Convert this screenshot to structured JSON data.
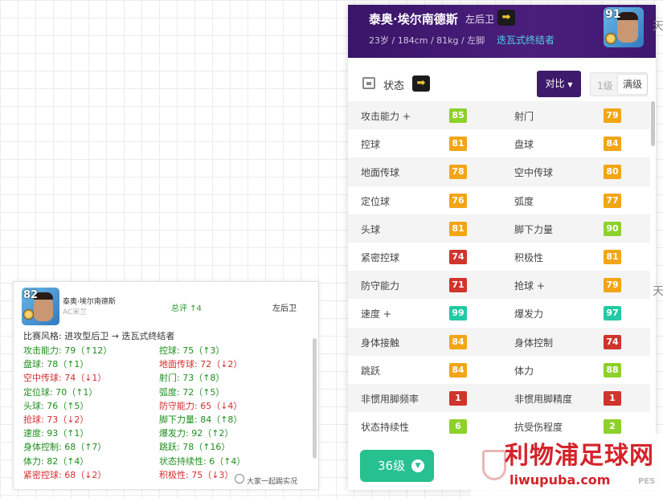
{
  "right_panel": {
    "player_name": "泰奥·埃尔南德斯",
    "position": "左后卫",
    "info": "23岁 / 184cm / 81kg / 左脚",
    "playing_style": "迭瓦式终结者",
    "rating": "91",
    "status_label": "状态",
    "compare_label": "对比",
    "level_1_label": "1级",
    "level_max_label": "满级",
    "level_button_label": "36级",
    "stats": [
      {
        "name": "攻击能力 +",
        "value": "85",
        "color": "#8dd12b"
      },
      {
        "name": "射门",
        "value": "79",
        "color": "#f2a516"
      },
      {
        "name": "控球",
        "value": "81",
        "color": "#f2a516"
      },
      {
        "name": "盘球",
        "value": "84",
        "color": "#f2a516"
      },
      {
        "name": "地面传球",
        "value": "78",
        "color": "#f2a516"
      },
      {
        "name": "空中传球",
        "value": "80",
        "color": "#f2a516"
      },
      {
        "name": "定位球",
        "value": "76",
        "color": "#f2a516"
      },
      {
        "name": "弧度",
        "value": "77",
        "color": "#f2a516"
      },
      {
        "name": "头球",
        "value": "81",
        "color": "#f2a516"
      },
      {
        "name": "脚下力量",
        "value": "90",
        "color": "#8dd12b"
      },
      {
        "name": "紧密控球",
        "value": "74",
        "color": "#d0342c"
      },
      {
        "name": "积极性",
        "value": "81",
        "color": "#f2a516"
      },
      {
        "name": "防守能力",
        "value": "71",
        "color": "#d0342c"
      },
      {
        "name": "抢球 +",
        "value": "79",
        "color": "#f2a516"
      },
      {
        "name": "速度 +",
        "value": "99",
        "color": "#22c9a4"
      },
      {
        "name": "爆发力",
        "value": "97",
        "color": "#22c9a4"
      },
      {
        "name": "身体接触",
        "value": "84",
        "color": "#f2a516"
      },
      {
        "name": "身体控制",
        "value": "74",
        "color": "#d0342c"
      },
      {
        "name": "跳跃",
        "value": "84",
        "color": "#f2a516"
      },
      {
        "name": "体力",
        "value": "88",
        "color": "#8dd12b"
      },
      {
        "name": "非惯用脚频率",
        "value": "1",
        "color": "#d0342c"
      },
      {
        "name": "非惯用脚精度",
        "value": "1",
        "color": "#d0342c"
      },
      {
        "name": "状态持续性",
        "value": "6",
        "color": "#8dd12b"
      },
      {
        "name": "抗受伤程度",
        "value": "2",
        "color": "#8dd12b"
      }
    ]
  },
  "left_card": {
    "rating": "82",
    "player_name": "泰奥·埃尔南德斯",
    "club": "AC米兰",
    "overall": "总评 ↑4",
    "position": "左后卫",
    "style_change": "比赛风格: 进攻型后卫 → 迭瓦式终结者",
    "wechat_label": "大家一起踢实况",
    "stats": [
      {
        "text": "攻击能力: 79（↑12）",
        "trend": "up"
      },
      {
        "text": "控球: 75（↑3）",
        "trend": "up"
      },
      {
        "text": "盘球: 78（↑1）",
        "trend": "up"
      },
      {
        "text": "地面传球: 72（↓2）",
        "trend": "down"
      },
      {
        "text": "空中传球: 74（↓1）",
        "trend": "down"
      },
      {
        "text": "射门: 73（↑8）",
        "trend": "up"
      },
      {
        "text": "定位球: 70（↑1）",
        "trend": "up"
      },
      {
        "text": "弧度: 72（↑5）",
        "trend": "up"
      },
      {
        "text": "头球: 76（↑5）",
        "trend": "up"
      },
      {
        "text": "防守能力: 65（↓4）",
        "trend": "down"
      },
      {
        "text": "抢球: 73（↓2）",
        "trend": "down"
      },
      {
        "text": "脚下力量: 84（↑8）",
        "trend": "up"
      },
      {
        "text": "速度: 93（↑1）",
        "trend": "up"
      },
      {
        "text": "爆发力: 92（↑2）",
        "trend": "up"
      },
      {
        "text": "身体控制: 68（↑7）",
        "trend": "up"
      },
      {
        "text": "跳跃: 78（↑16）",
        "trend": "up"
      },
      {
        "text": "体力: 82（↑4）",
        "trend": "up"
      },
      {
        "text": "状态持续性: 6（↑4）",
        "trend": "up"
      },
      {
        "text": "紧密控球: 68（↓2）",
        "trend": "down"
      },
      {
        "text": "积极性: 75（↓3）",
        "trend": "down"
      }
    ]
  },
  "watermark": {
    "cn": "利物浦足球网",
    "en": "liwupuba.com",
    "pes": "PES"
  },
  "edge_text": "天"
}
